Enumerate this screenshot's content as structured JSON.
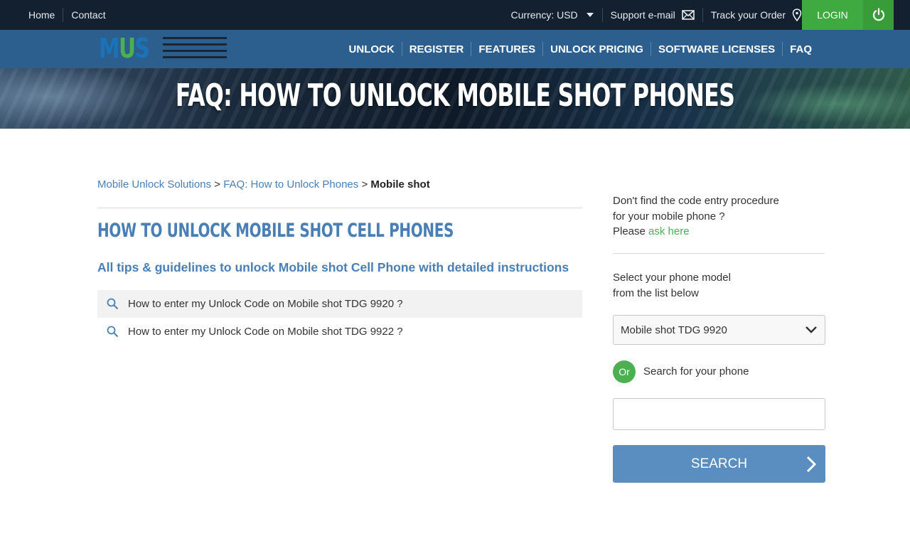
{
  "topbar": {
    "links": [
      "Home",
      "Contact"
    ],
    "currency": "Currency: USD",
    "support": "Support e-mail",
    "track": "Track your Order",
    "login": "LOGIN"
  },
  "logo": {
    "text": "MUS",
    "colors": [
      "#1a73b8",
      "#4caf50",
      "#1a73b8"
    ]
  },
  "nav": {
    "items": [
      "UNLOCK",
      "REGISTER",
      "FEATURES",
      "UNLOCK PRICING",
      "SOFTWARE LICENSES",
      "FAQ"
    ]
  },
  "banner": {
    "title": "FAQ: HOW TO UNLOCK MOBILE SHOT PHONES"
  },
  "breadcrumb": {
    "items": [
      "Mobile Unlock Solutions",
      "FAQ: How to Unlock Phones"
    ],
    "separator": ">",
    "current": "Mobile shot"
  },
  "main": {
    "title": "HOW TO UNLOCK MOBILE SHOT CELL PHONES",
    "subtitle": "All tips & guidelines to unlock Mobile shot Cell Phone with detailed instructions",
    "faqs": [
      "How to enter my Unlock Code on Mobile shot TDG 9920 ?",
      "How to enter my Unlock Code on Mobile shot TDG 9922 ?"
    ]
  },
  "sidebar": {
    "note_line1": "Don't find the code entry procedure",
    "note_line2": "for your mobile phone ?",
    "note_please": "Please",
    "note_link": "ask here",
    "select_label_line1": "Select your phone model",
    "select_label_line2": "from the list below",
    "selected_model": "Mobile shot TDG 9920",
    "or_badge": "Or",
    "or_text": "Search for your phone",
    "search_value": "",
    "search_button": "SEARCH"
  },
  "colors": {
    "topbar": "#13202f",
    "navbar": "#2c5f8d",
    "accent_blue": "#4a7fb5",
    "accent_green": "#4caf50",
    "button": "#5a8ec0"
  }
}
